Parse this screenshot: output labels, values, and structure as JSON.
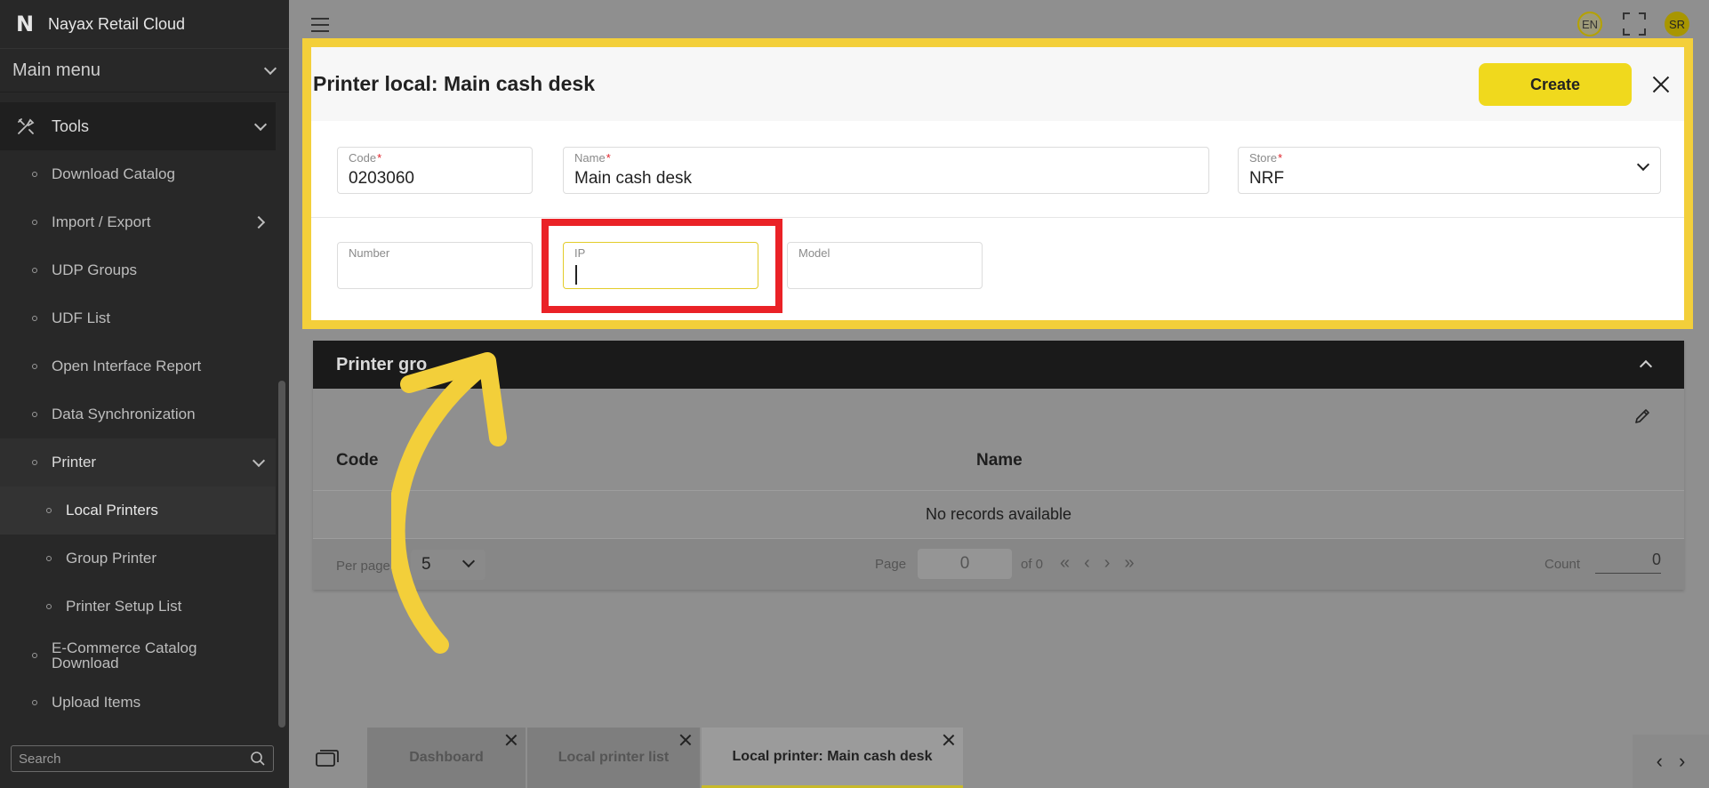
{
  "sidebar": {
    "brand": "Nayax Retail Cloud",
    "main_menu": "Main menu",
    "tools": "Tools",
    "items": {
      "download_catalog": "Download Catalog",
      "import_export": "Import / Export",
      "udp_groups": "UDP Groups",
      "udf_list": "UDF List",
      "open_interface_report": "Open Interface Report",
      "data_sync": "Data Synchronization",
      "printer": "Printer",
      "local_printers": "Local Printers",
      "group_printer": "Group Printer",
      "printer_setup_list": "Printer Setup List",
      "ecommerce_line1": "E-Commerce Catalog",
      "ecommerce_line2": "Download",
      "upload_items": "Upload Items"
    },
    "search_placeholder": "Search"
  },
  "topbar": {
    "lang": "EN",
    "avatar": "SR"
  },
  "dialog": {
    "title": "Printer local: Main cash desk",
    "create_label": "Create",
    "fields": {
      "code_label": "Code",
      "code_value": "0203060",
      "name_label": "Name",
      "name_value": "Main cash desk",
      "store_label": "Store",
      "store_value": "NRF",
      "number_label": "Number",
      "number_value": "",
      "ip_label": "IP",
      "ip_value": "",
      "model_label": "Model",
      "model_value": "",
      "required_mark": "*"
    }
  },
  "printer_group": {
    "title": "Printer gro",
    "columns": {
      "code": "Code",
      "name": "Name"
    },
    "empty": "No records available",
    "pager": {
      "per_page_label": "Per page:",
      "per_page_value": "5",
      "page_label": "Page",
      "page_value": "0",
      "of_label": "of 0",
      "count_label": "Count",
      "count_value": "0"
    }
  },
  "tabs": [
    {
      "label": "Dashboard"
    },
    {
      "label": "Local printer list"
    },
    {
      "label": "Local printer: Main cash desk"
    }
  ],
  "colors": {
    "highlight_yellow": "#f3cf3a",
    "highlight_red": "#ea2227",
    "create_button": "#f0d91d"
  }
}
